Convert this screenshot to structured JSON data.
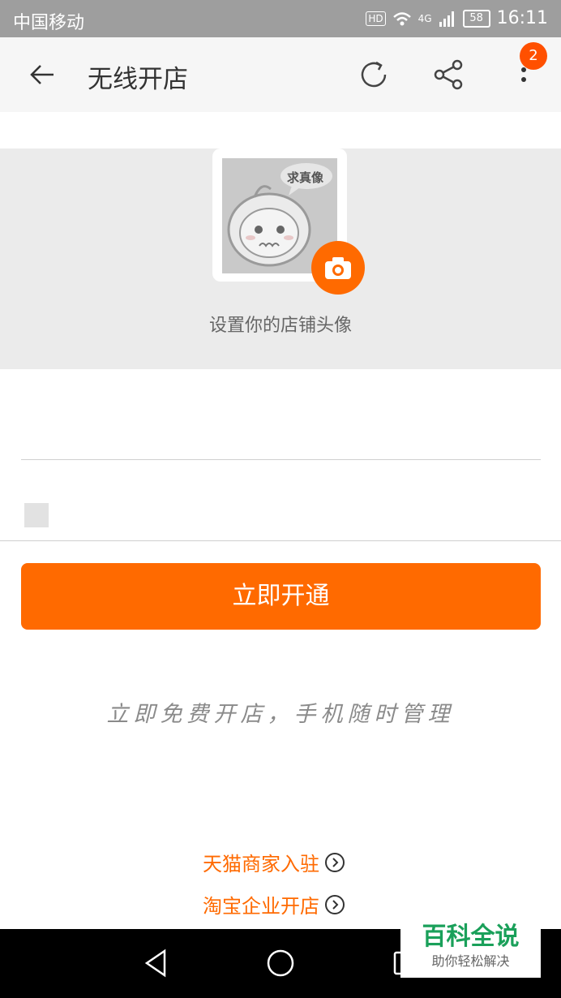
{
  "statusbar": {
    "carrier": "中国移动",
    "hd": "HD",
    "network": "4G",
    "battery": "58",
    "time": "16:11"
  },
  "appbar": {
    "title": "无线开店",
    "notification_count": "2",
    "icons": [
      "back-arrow-icon",
      "refresh-icon",
      "share-icon",
      "more-icon"
    ]
  },
  "avatar": {
    "bubble_text": "求真像",
    "caption": "设置你的店铺头像"
  },
  "form": {
    "field1_value": "",
    "field2_value": ""
  },
  "submit_label": "立即开通",
  "slogan": "立即免费开店，手机随时管理",
  "links": {
    "tmall": "天猫商家入驻",
    "taobao": "淘宝企业开店"
  },
  "watermark": {
    "title": "百科全说",
    "subtitle": "助你轻松解决"
  },
  "colors": {
    "accent": "#ff6a00",
    "badge": "#ff5000",
    "statusbar": "#9e9e9e"
  }
}
